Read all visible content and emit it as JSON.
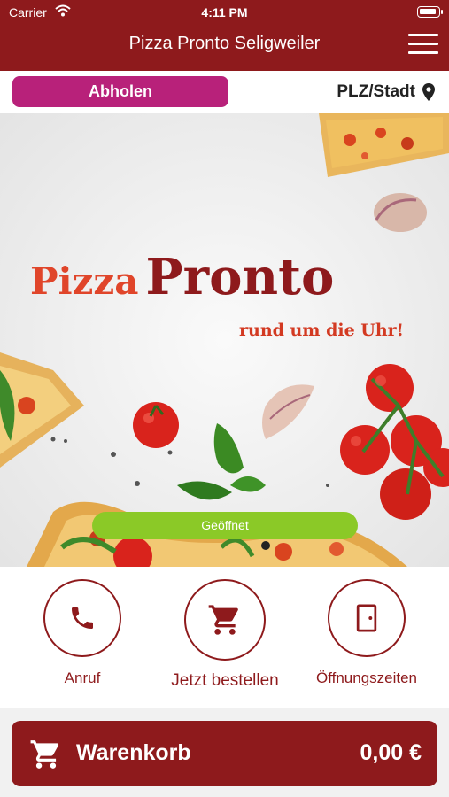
{
  "status_bar": {
    "carrier": "Carrier",
    "time": "4:11 PM"
  },
  "header": {
    "title": "Pizza Pronto Seligweiler",
    "menu_icon": "hamburger-menu-icon"
  },
  "top_bar": {
    "pickup_label": "Abholen",
    "location_label": "PLZ/Stadt",
    "location_icon": "map-pin-icon"
  },
  "hero": {
    "title_word1": "Pizza",
    "title_word2": "Pronto",
    "subtitle": "rund um die Uhr!",
    "open_badge": "Geöffnet"
  },
  "actions": [
    {
      "label": "Anruf",
      "icon": "phone-icon"
    },
    {
      "label": "Jetzt bestellen",
      "icon": "shopping-cart-icon"
    },
    {
      "label": "Öffnungszeiten",
      "icon": "door-icon"
    }
  ],
  "cart": {
    "label": "Warenkorb",
    "total": "0,00 €",
    "icon": "shopping-cart-icon"
  },
  "colors": {
    "primary": "#8e1a1c",
    "pickup": "#b8217a",
    "open": "#8bc927",
    "accent": "#e0452a"
  }
}
